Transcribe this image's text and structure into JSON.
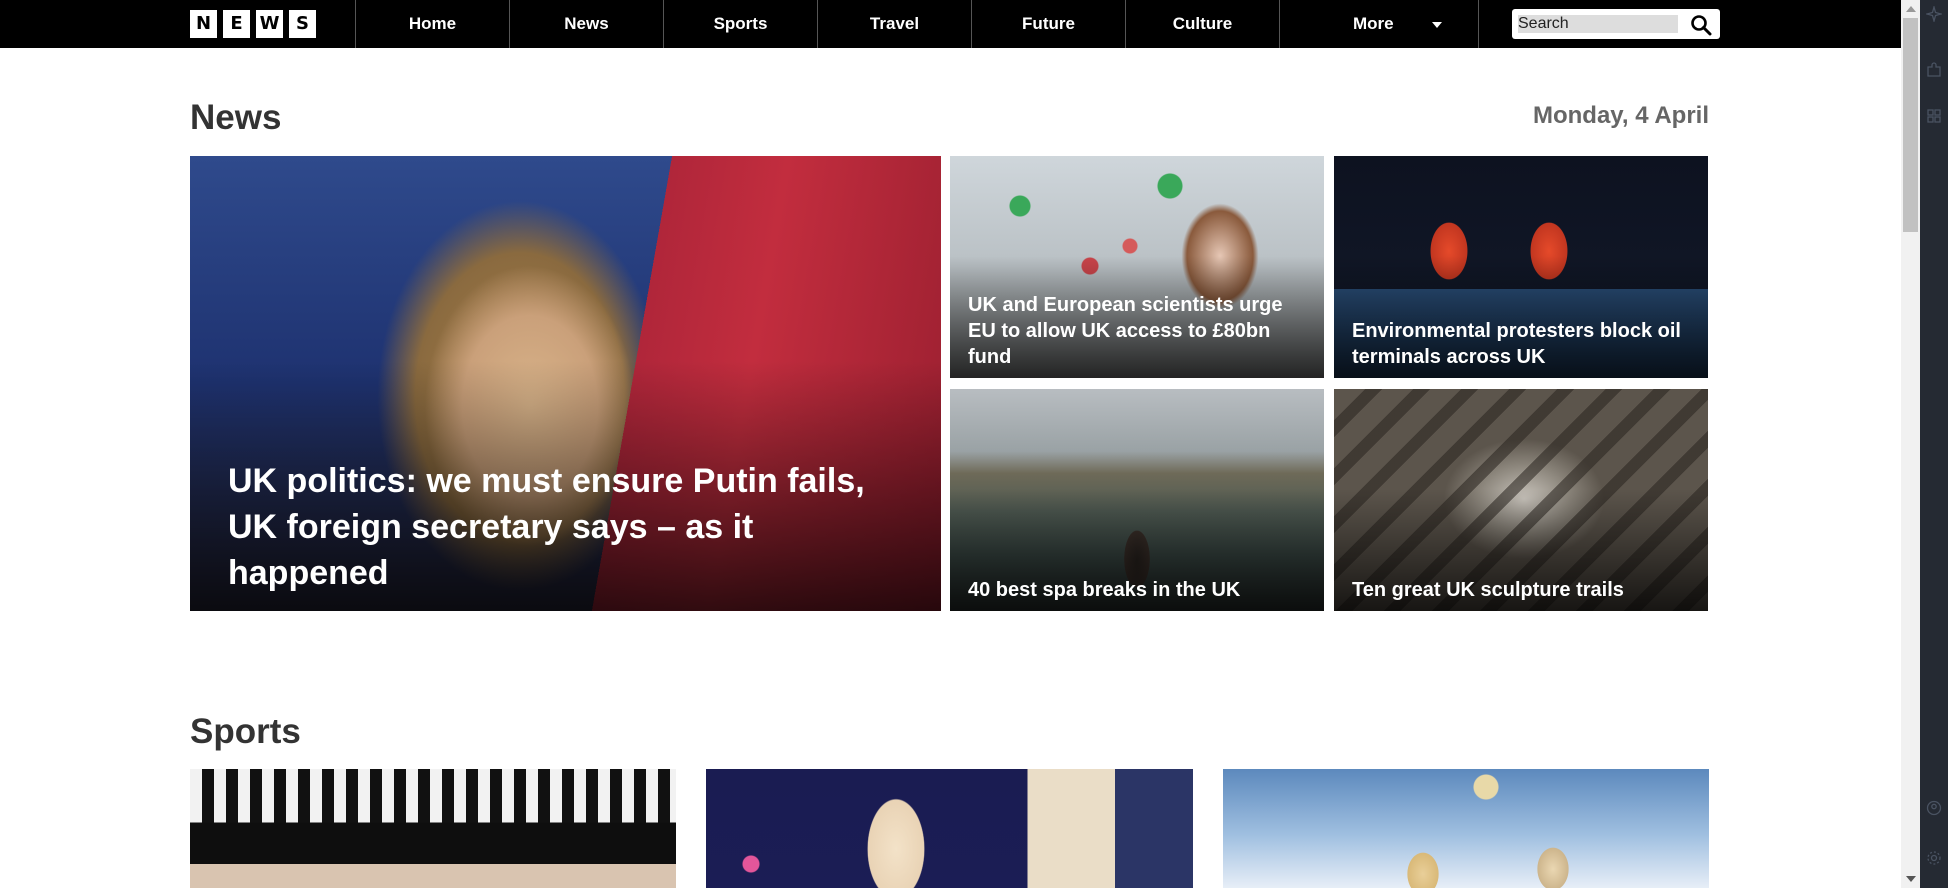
{
  "nav": {
    "logo_letters": [
      "N",
      "E",
      "W",
      "S"
    ],
    "items": [
      {
        "label": "Home"
      },
      {
        "label": "News"
      },
      {
        "label": "Sports"
      },
      {
        "label": "Travel"
      },
      {
        "label": "Future"
      },
      {
        "label": "Culture"
      }
    ],
    "more_label": "More",
    "search_placeholder": "Search"
  },
  "news": {
    "title": "News",
    "date": "Monday, 4 April",
    "featured": {
      "headline": "UK politics: we must ensure Putin fails, UK foreign secretary says – as it happened"
    },
    "stories": [
      {
        "headline": "UK and European scientists urge EU to allow UK access to £80bn fund"
      },
      {
        "headline": "Environmental protesters block oil terminals across UK"
      },
      {
        "headline": "40 best spa breaks in the UK"
      },
      {
        "headline": "Ten great UK sculpture trails"
      }
    ]
  },
  "sports": {
    "title": "Sports"
  },
  "colors": {
    "nav_bg": "#000000",
    "heading": "#333333",
    "date": "#666666"
  }
}
